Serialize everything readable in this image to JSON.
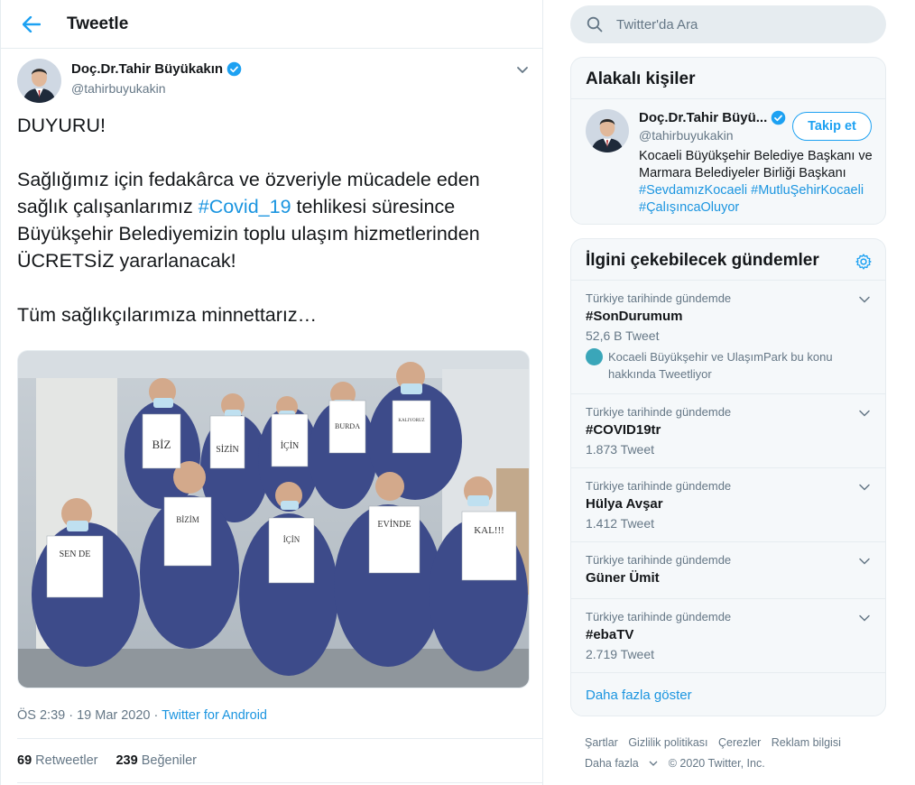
{
  "header": {
    "title": "Tweetle"
  },
  "tweet": {
    "author_name": "Doç.Dr.Tahir Büyükakın",
    "author_handle": "@tahirbuyukakin",
    "text_line1": "DUYURU!",
    "text_p2_a": "Sağlığımız için fedakârca ve özveriyle mücadele eden sağlık çalışanlarımız ",
    "text_p2_hashtag": "#Covid_19",
    "text_p2_b": " tehlikesi süresince Büyükşehir Belediyemizin toplu ulaşım hizmetlerinden ÜCRETSİZ yararlanacak!",
    "text_p3": "Tüm sağlıkçılarımıza minnettarız…",
    "photo_signs": [
      "BİZ",
      "SİZİN",
      "İÇİN",
      "BURDA",
      "KALIYORUZ",
      "SEN DE",
      "BİZİM",
      "İÇİN",
      "EVİNDE",
      "KAL!!!"
    ],
    "time": "ÖS 2:39 · 19 Mar 2020 · ",
    "source": "Twitter for Android",
    "retweets": "69",
    "retweets_label": "Retweetler",
    "likes": "239",
    "likes_label": "Beğeniler"
  },
  "search": {
    "placeholder": "Twitter'da Ara"
  },
  "relevant": {
    "title": "Alakalı kişiler",
    "name": "Doç.Dr.Tahir Büyü...",
    "handle": "@tahirbuyukakin",
    "follow_label": "Takip et",
    "bio_text": "Kocaeli Büyükşehir Belediye Başkanı ve Marmara Belediyeler Birliği Başkanı ",
    "bio_tag1": "#SevdamızKocaeli",
    "bio_tag2": "#MutluŞehirKocaeli",
    "bio_tag3": "#ÇalışıncaOluyor"
  },
  "trends": {
    "title": "İlgini çekebilecek gündemler",
    "items": [
      {
        "context": "Türkiye tarihinde gündemde",
        "name": "#SonDurumum",
        "count": "52,6 B Tweet",
        "promo": "Kocaeli Büyükşehir ve UlaşımPark bu konu hakkında Tweetliyor"
      },
      {
        "context": "Türkiye tarihinde gündemde",
        "name": "#COVID19tr",
        "count": "1.873 Tweet"
      },
      {
        "context": "Türkiye tarihinde gündemde",
        "name": "Hülya Avşar",
        "count": "1.412 Tweet"
      },
      {
        "context": "Türkiye tarihinde gündemde",
        "name": "Güner Ümit"
      },
      {
        "context": "Türkiye tarihinde gündemde",
        "name": "#ebaTV",
        "count": "2.719 Tweet"
      }
    ],
    "show_more": "Daha fazla göster"
  },
  "footer": {
    "links": [
      "Şartlar",
      "Gizlilik politikası",
      "Çerezler",
      "Reklam bilgisi"
    ],
    "more": "Daha fazla",
    "copyright": "© 2020 Twitter, Inc."
  },
  "colors": {
    "accent": "#1da1f2",
    "link": "#1b95e0",
    "verified": "#1da1f2"
  }
}
